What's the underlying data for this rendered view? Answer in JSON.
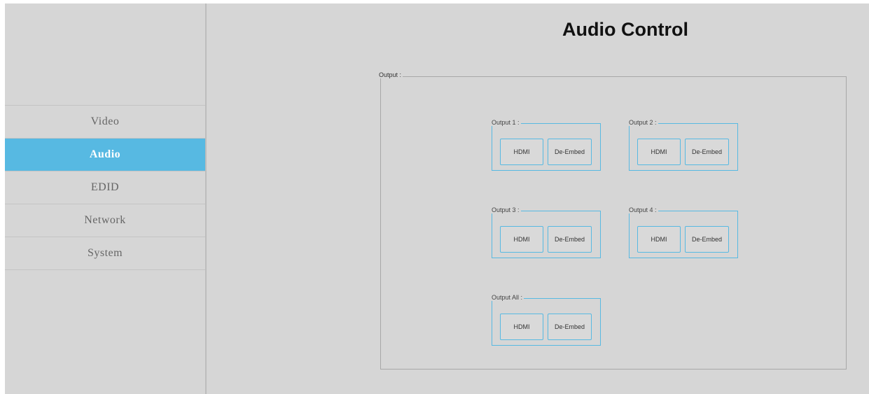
{
  "sidebar": {
    "items": [
      {
        "label": "Video",
        "active": false
      },
      {
        "label": "Audio",
        "active": true
      },
      {
        "label": "EDID",
        "active": false
      },
      {
        "label": "Network",
        "active": false
      },
      {
        "label": "System",
        "active": false
      }
    ]
  },
  "main": {
    "title": "Audio Control",
    "output_legend": "Output :",
    "groups": [
      {
        "legend": "Output 1 :",
        "hdmi": "HDMI",
        "deembed": "De-Embed"
      },
      {
        "legend": "Output 2 :",
        "hdmi": "HDMI",
        "deembed": "De-Embed"
      },
      {
        "legend": "Output 3 :",
        "hdmi": "HDMI",
        "deembed": "De-Embed"
      },
      {
        "legend": "Output 4 :",
        "hdmi": "HDMI",
        "deembed": "De-Embed"
      },
      {
        "legend": "Output All :",
        "hdmi": "HDMI",
        "deembed": "De-Embed"
      }
    ]
  },
  "colors": {
    "accent": "#57b9e2",
    "background": "#d6d6d6"
  }
}
